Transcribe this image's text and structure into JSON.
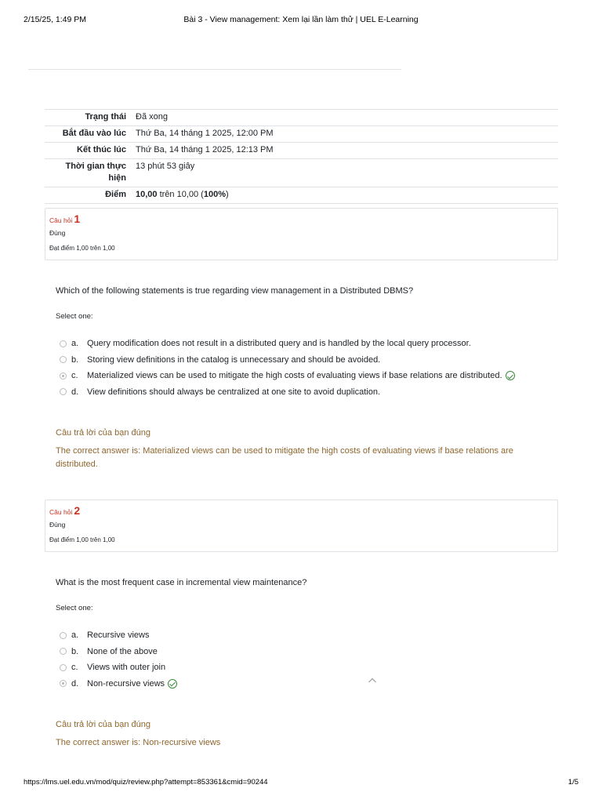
{
  "print_header": {
    "date": "2/15/25, 1:49 PM",
    "title": "Bài 3 - View management: Xem lại lần làm thử | UEL E-Learning"
  },
  "print_footer": {
    "url": "https://lms.uel.edu.vn/mod/quiz/review.php?attempt=853361&cmid=90244",
    "page": "1/5"
  },
  "summary": {
    "state_label": "Trạng thái",
    "state_value": "Đã xong",
    "started_label": "Bắt đầu vào lúc",
    "started_value": "Thứ Ba, 14 tháng 1 2025, 12:00 PM",
    "completed_label": "Kết thúc lúc",
    "completed_value": "Thứ Ba, 14 tháng 1 2025, 12:13 PM",
    "time_label": "Thời gian thực hiện",
    "time_value": "13 phút 53 giây",
    "grade_label": "Điểm",
    "grade_score": "10,00",
    "grade_mid": " trên 10,00 (",
    "grade_percent": "100%",
    "grade_end": ")"
  },
  "questions": [
    {
      "label": "Câu hỏi",
      "number": "1",
      "state": "Đúng",
      "grade": "Đạt điểm 1,00 trên 1,00",
      "text": "Which of the following statements is true regarding view management in a Distributed DBMS?",
      "prompt": "Select one:",
      "answers": [
        {
          "letter": "a.",
          "text": "Query modification does not result in a distributed query and is handled by the local query processor.",
          "selected": false
        },
        {
          "letter": "b.",
          "text": "Storing view definitions in the catalog is unnecessary and should be avoided.",
          "selected": false
        },
        {
          "letter": "c.",
          "text": "Materialized views can be used to mitigate the high costs of evaluating views if base relations are distributed.",
          "selected": true
        },
        {
          "letter": "d.",
          "text": "View definitions should always be centralized at one site to avoid duplication.",
          "selected": false
        }
      ],
      "feedback_title": "Câu trả lời của bạn đúng",
      "correct_answer": "The correct answer is: Materialized views can be used to mitigate the high costs of evaluating views if base relations are distributed."
    },
    {
      "label": "Câu hỏi",
      "number": "2",
      "state": "Đúng",
      "grade": "Đạt điểm 1,00 trên 1,00",
      "text": "What is the most frequent case in incremental view maintenance?",
      "prompt": "Select one:",
      "answers": [
        {
          "letter": "a.",
          "text": "Recursive views",
          "selected": false
        },
        {
          "letter": "b.",
          "text": "None of the above",
          "selected": false
        },
        {
          "letter": "c.",
          "text": "Views with outer join",
          "selected": false
        },
        {
          "letter": "d.",
          "text": "Non-recursive views",
          "selected": true
        }
      ],
      "feedback_title": "Câu trả lời của bạn đúng",
      "correct_answer": "The correct answer is: Non-recursive views"
    }
  ],
  "icons": {
    "correct": "check-circle-icon",
    "back_to_top": "chevron-up-icon"
  },
  "colors": {
    "question_number": "#ca3120",
    "feedback": "#8e662e",
    "correct_check": "#3c8a3e"
  }
}
